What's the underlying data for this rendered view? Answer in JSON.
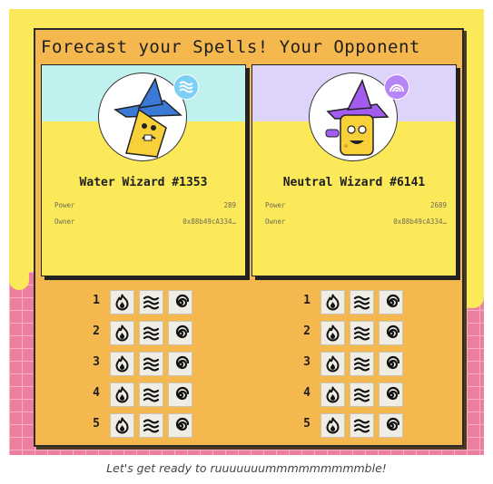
{
  "title": "Forecast your Spells! Your Opponent",
  "colors": {
    "panel": "#f5b84f",
    "yellow": "#fbe95a",
    "pink": "#ec7f9d",
    "water": "#7ecff4",
    "neutral": "#b685f7"
  },
  "cards": [
    {
      "name": "Water Wizard #1353",
      "power_label": "Power",
      "power": "289",
      "owner_label": "Owner",
      "owner": "0x88b49cA334…",
      "element_icon": "water-wave-icon",
      "hat_icon": "blue-wizard-hat"
    },
    {
      "name": "Neutral Wizard #6141",
      "power_label": "Power",
      "power": "2689",
      "owner_label": "Owner",
      "owner": "0x88b49cA334…",
      "element_icon": "neutral-arcs-icon",
      "hat_icon": "purple-wizard-hat"
    }
  ],
  "rounds": [
    "1",
    "2",
    "3",
    "4",
    "5"
  ],
  "spells": [
    {
      "key": "fire",
      "icon": "fire-spell-icon"
    },
    {
      "key": "water",
      "icon": "water-spell-icon"
    },
    {
      "key": "wind",
      "icon": "wind-spiral-spell-icon"
    }
  ],
  "caption": "Let's get ready to ruuuuuuummmmmmmmmble!"
}
